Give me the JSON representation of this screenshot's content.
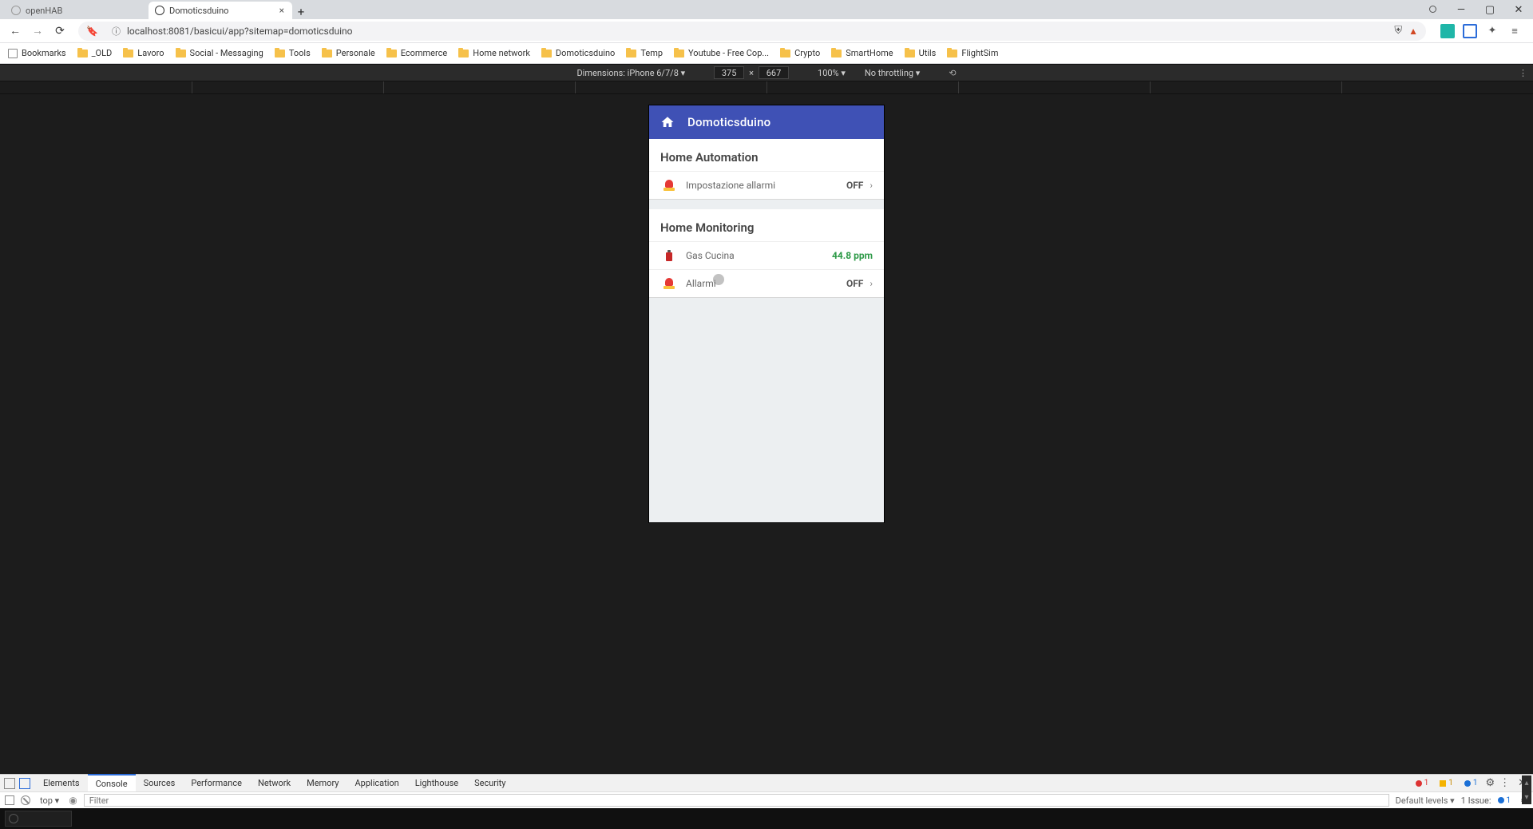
{
  "tabs": {
    "inactive": {
      "title": "openHAB"
    },
    "active": {
      "title": "Domoticsduino"
    }
  },
  "url": "localhost:8081/basicui/app?sitemap=domoticsduino",
  "bookmarks": [
    "Bookmarks",
    "_OLD",
    "Lavoro",
    "Social - Messaging",
    "Tools",
    "Personale",
    "Ecommerce",
    "Home network",
    "Domoticsduino",
    "Temp",
    "Youtube - Free Cop...",
    "Crypto",
    "SmartHome",
    "Utils",
    "FlightSim"
  ],
  "device_bar": {
    "dimensions_label": "Dimensions: iPhone 6/7/8 ▾",
    "width": "375",
    "height": "667",
    "zoom": "100% ▾",
    "throttle": "No throttling ▾"
  },
  "app": {
    "title": "Domoticsduino",
    "sections": [
      {
        "title": "Home Automation",
        "items": [
          {
            "icon": "alarm",
            "label": "Impostazione allarmi",
            "value": "OFF",
            "value_class": "",
            "chevron": true,
            "cursor": false
          }
        ]
      },
      {
        "title": "Home Monitoring",
        "items": [
          {
            "icon": "gas",
            "label": "Gas Cucina",
            "value": "44.8 ppm",
            "value_class": "green",
            "chevron": false,
            "cursor": false
          },
          {
            "icon": "alarm",
            "label": "Allarmi",
            "value": "OFF",
            "value_class": "",
            "chevron": true,
            "cursor": true
          }
        ]
      }
    ]
  },
  "devtools": {
    "tabs": [
      "Elements",
      "Console",
      "Sources",
      "Performance",
      "Network",
      "Memory",
      "Application",
      "Lighthouse",
      "Security"
    ],
    "active_tab": "Console",
    "errors": "1",
    "warnings": "1",
    "info": "1",
    "console": {
      "scope": "top ▾",
      "filter_placeholder": "Filter",
      "levels": "Default levels ▾",
      "issues_label": "1 Issue:",
      "issues_count": "1"
    }
  }
}
